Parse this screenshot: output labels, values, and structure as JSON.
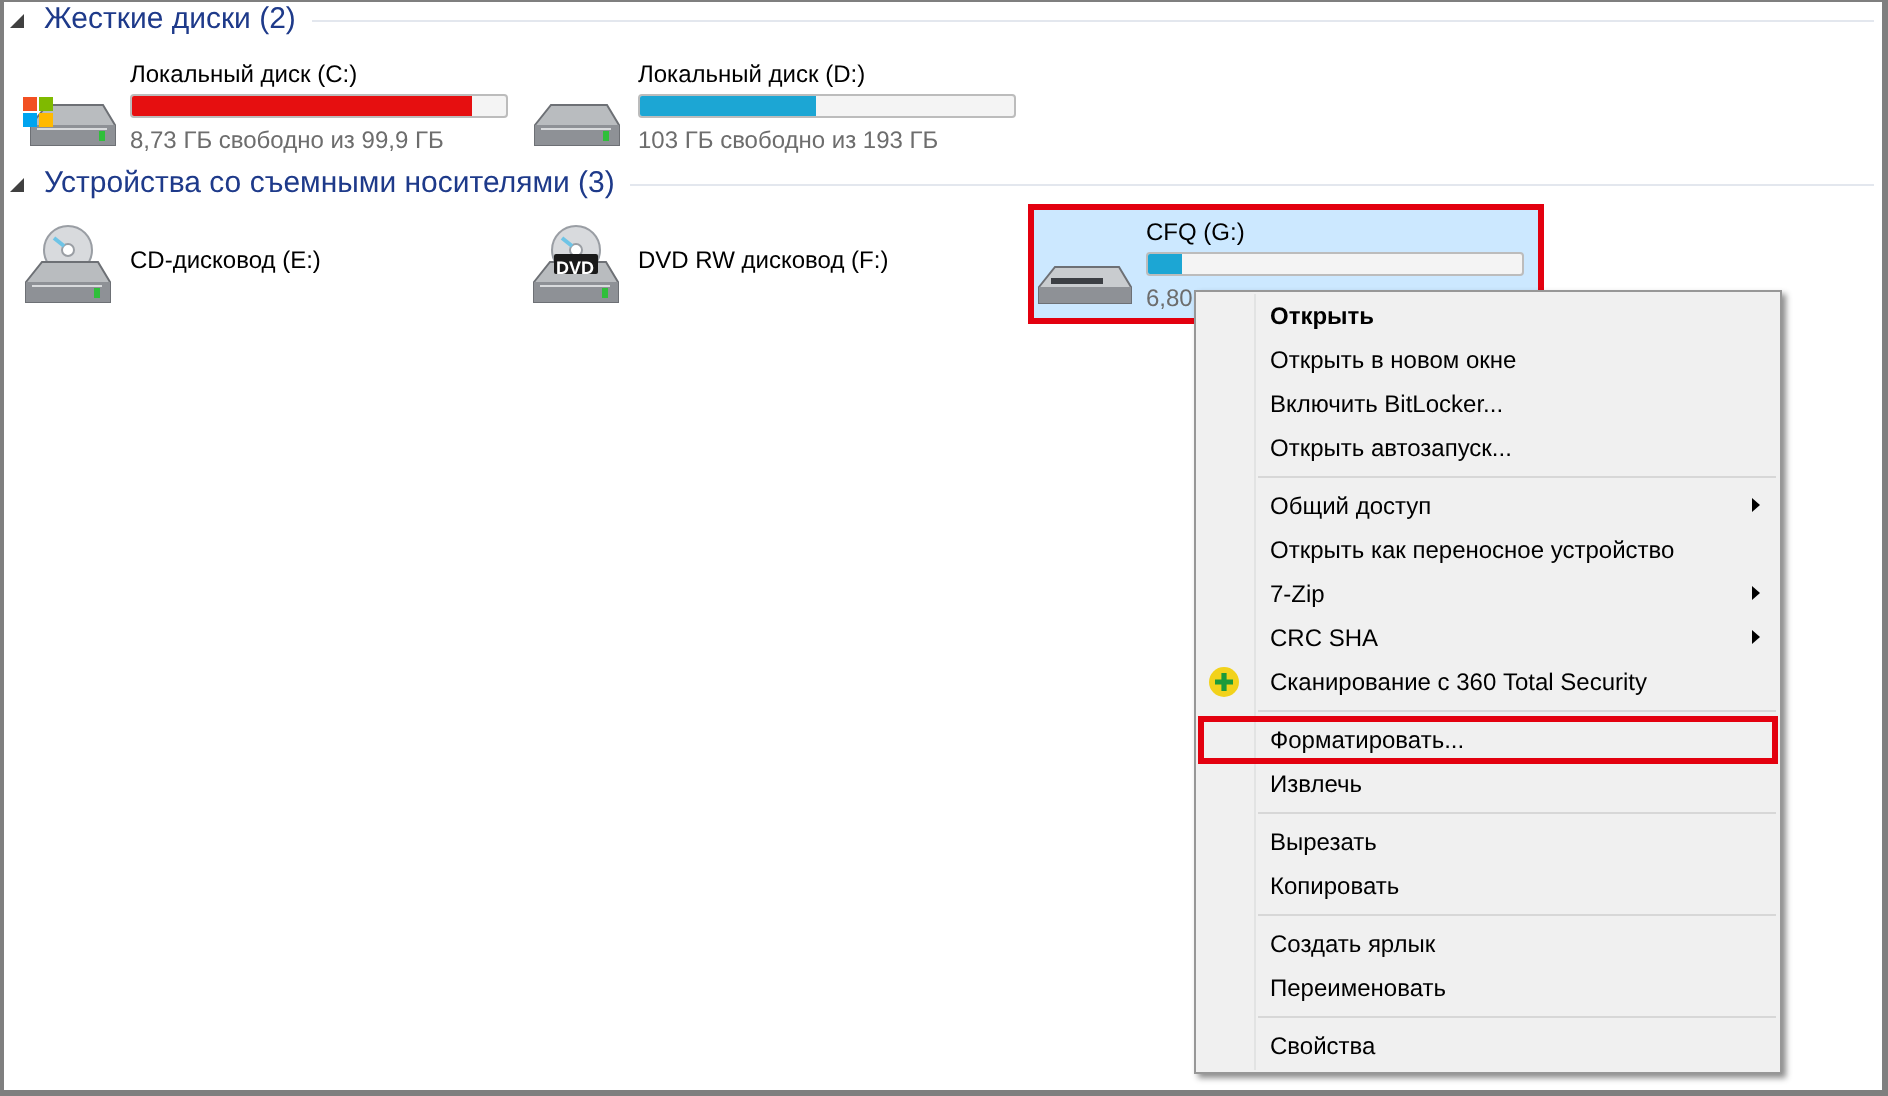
{
  "sections": [
    {
      "title": "Жесткие диски (2)",
      "expanded": true,
      "items": [
        {
          "kind": "system_disk",
          "name": "Локальный диск (C:)",
          "level": 0.91,
          "free": "8,73 ГБ свободно из 99,9 ГБ",
          "selected": false,
          "annotated": false
        },
        {
          "kind": "disk",
          "name": "Локальный диск (D:)",
          "level": 0.47,
          "free": "103 ГБ свободно из 193 ГБ",
          "selected": false,
          "annotated": false
        }
      ]
    },
    {
      "title": "Устройства со съемными носителями (3)",
      "expanded": true,
      "items": [
        {
          "kind": "cd",
          "name": "CD-дисковод (E:)",
          "selected": false,
          "annotated": false
        },
        {
          "kind": "dvd",
          "name": "DVD RW дисковод (F:)",
          "badge": "DVD",
          "selected": false,
          "annotated": false
        },
        {
          "kind": "usb",
          "name": "CFQ (G:)",
          "level": 0.09,
          "free": "6,80",
          "selected": true,
          "annotated": true
        }
      ]
    }
  ],
  "context_menu": {
    "groups": [
      [
        {
          "label": "Открыть",
          "default": true,
          "submenu": false,
          "annotated": false
        },
        {
          "label": "Открыть в новом окне",
          "default": false,
          "submenu": false,
          "annotated": false
        },
        {
          "label": "Включить BitLocker...",
          "default": false,
          "submenu": false,
          "annotated": false
        },
        {
          "label": "Открыть автозапуск...",
          "default": false,
          "submenu": false,
          "annotated": false
        }
      ],
      [
        {
          "label": "Общий доступ",
          "default": false,
          "submenu": true,
          "annotated": false
        },
        {
          "label": "Открыть как переносное устройство",
          "default": false,
          "submenu": false,
          "annotated": false
        },
        {
          "label": "7-Zip",
          "default": false,
          "submenu": true,
          "annotated": false
        },
        {
          "label": "CRC SHA",
          "default": false,
          "submenu": true,
          "annotated": false
        },
        {
          "label": "Сканирование с 360 Total Security",
          "default": false,
          "submenu": false,
          "kind": "antivirus",
          "annotated": false
        }
      ],
      [
        {
          "label": "Форматировать...",
          "default": false,
          "submenu": false,
          "annotated": true
        },
        {
          "label": "Извлечь",
          "default": false,
          "submenu": false,
          "annotated": false
        }
      ],
      [
        {
          "label": "Вырезать",
          "default": false,
          "submenu": false,
          "annotated": false
        },
        {
          "label": "Копировать",
          "default": false,
          "submenu": false,
          "annotated": false
        }
      ],
      [
        {
          "label": "Создать ярлык",
          "default": false,
          "submenu": false,
          "annotated": false
        },
        {
          "label": "Переименовать",
          "default": false,
          "submenu": false,
          "annotated": false
        }
      ],
      [
        {
          "label": "Свойства",
          "default": false,
          "submenu": false,
          "annotated": false
        }
      ]
    ]
  }
}
